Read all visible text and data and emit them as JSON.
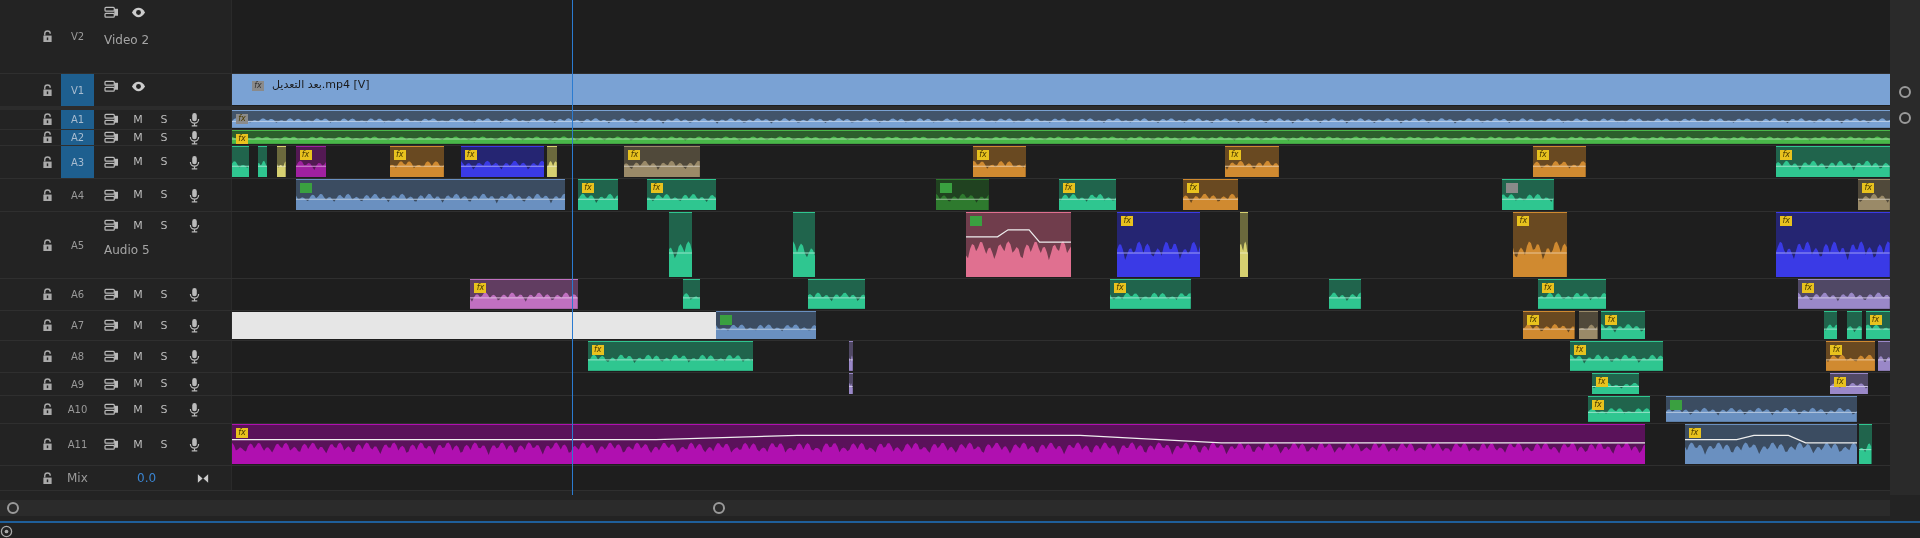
{
  "tracks": [
    {
      "kind": "video",
      "label": "V2",
      "name": "Video 2",
      "targeted": false
    },
    {
      "kind": "video",
      "label": "V1",
      "targeted": true,
      "clips": [
        {
          "kind": "video",
          "color": "#7aa2d4",
          "title": "بعد التعديل.mp4 [V]",
          "badge": {
            "text": "fx",
            "color": "#8a8a8a"
          }
        }
      ]
    },
    {
      "kind": "audio",
      "label": "A1",
      "mute": "M",
      "solo": "S",
      "targeted": true,
      "clips": [
        {
          "kind": "audio",
          "color": "#7aa2d4",
          "badge": {
            "text": "fx",
            "color": "#8a8a8a"
          }
        }
      ]
    },
    {
      "kind": "audio",
      "label": "A2",
      "mute": "M",
      "solo": "S",
      "targeted": true,
      "clips": [
        {
          "kind": "audio",
          "color": "#49b849",
          "badge": {
            "text": "fx",
            "color": "#e8c21e"
          }
        }
      ]
    },
    {
      "kind": "audio",
      "label": "A3",
      "mute": "M",
      "solo": "S",
      "targeted": true,
      "clips": [
        {
          "kind": "audio",
          "color": "#2fc690"
        },
        {
          "kind": "audio",
          "color": "#2fc690"
        },
        {
          "kind": "audio",
          "color": "#d6d070"
        },
        {
          "kind": "audio",
          "color": "#a020a0",
          "badge": {
            "text": "fx",
            "color": "#e8c21e"
          }
        },
        {
          "kind": "audio",
          "color": "#d08a30",
          "badge": {
            "text": "fx",
            "color": "#e8c21e"
          }
        },
        {
          "kind": "audio",
          "color": "#3a3ae6",
          "badge": {
            "text": "fx",
            "color": "#e8c21e"
          }
        },
        {
          "kind": "audio",
          "color": "#d6d070"
        },
        {
          "kind": "audio",
          "color": "#9a8a68",
          "badge": {
            "text": "fx",
            "color": "#e8c21e"
          }
        },
        {
          "kind": "audio",
          "color": "#d08a30",
          "badge": {
            "text": "fx",
            "color": "#e8c21e"
          }
        },
        {
          "kind": "audio",
          "color": "#d08a30",
          "badge": {
            "text": "fx",
            "color": "#e8c21e"
          }
        },
        {
          "kind": "audio",
          "color": "#d08a30",
          "badge": {
            "text": "fx",
            "color": "#e8c21e"
          }
        },
        {
          "kind": "audio",
          "color": "#2fc690",
          "badge": {
            "text": "fx",
            "color": "#e8c21e"
          }
        }
      ]
    },
    {
      "kind": "audio",
      "label": "A4",
      "mute": "M",
      "solo": "S",
      "targeted": false,
      "clips": [
        {
          "kind": "audio",
          "color": "#6a90c0",
          "badge": {
            "color": "#3aa040"
          }
        },
        {
          "kind": "audio",
          "color": "#2fc690",
          "badge": {
            "text": "fx",
            "color": "#e8c21e"
          }
        },
        {
          "kind": "audio",
          "color": "#2fc690",
          "badge": {
            "text": "fx",
            "color": "#e8c21e"
          }
        },
        {
          "kind": "audio",
          "color": "#2e7a2e",
          "badge": {
            "color": "#3aa040"
          }
        },
        {
          "kind": "audio",
          "color": "#2fc690",
          "badge": {
            "text": "fx",
            "color": "#e8c21e"
          }
        },
        {
          "kind": "audio",
          "color": "#d08a30",
          "badge": {
            "text": "fx",
            "color": "#e8c21e"
          }
        },
        {
          "kind": "audio",
          "color": "#2fc690",
          "badge": {
            "color": "#8a8a8a"
          }
        },
        {
          "kind": "audio",
          "color": "#9a8a68",
          "badge": {
            "text": "fx",
            "color": "#e8c21e"
          }
        }
      ]
    },
    {
      "kind": "audio",
      "label": "A5",
      "name": "Audio 5",
      "mute": "M",
      "solo": "S",
      "targeted": false,
      "clips": [
        {
          "kind": "audio",
          "color": "#2fc690"
        },
        {
          "kind": "audio",
          "color": "#2fc690"
        },
        {
          "kind": "audio",
          "color": "#e07090",
          "badge": {
            "color": "#3aa040"
          },
          "keyframes": true
        },
        {
          "kind": "audio",
          "color": "#3a3ae6",
          "badge": {
            "text": "fx",
            "color": "#e8c21e"
          }
        },
        {
          "kind": "audio",
          "color": "#d6d070"
        },
        {
          "kind": "audio",
          "color": "#d08a30",
          "badge": {
            "text": "fx",
            "color": "#e8c21e"
          }
        },
        {
          "kind": "audio",
          "color": "#3a3ae6",
          "badge": {
            "text": "fx",
            "color": "#e8c21e"
          }
        }
      ]
    },
    {
      "kind": "audio",
      "label": "A6",
      "mute": "M",
      "solo": "S",
      "targeted": false,
      "clips": [
        {
          "kind": "audio",
          "color": "#c070c0",
          "badge": {
            "text": "fx",
            "color": "#e8c21e"
          }
        },
        {
          "kind": "audio",
          "color": "#2fc690"
        },
        {
          "kind": "audio",
          "color": "#2fc690"
        },
        {
          "kind": "audio",
          "color": "#2fc690",
          "badge": {
            "text": "fx",
            "color": "#e8c21e"
          }
        },
        {
          "kind": "audio",
          "color": "#2fc690"
        },
        {
          "kind": "audio",
          "color": "#2fc690",
          "badge": {
            "text": "fx",
            "color": "#e8c21e"
          }
        },
        {
          "kind": "audio",
          "color": "#9a88c8",
          "badge": {
            "text": "fx",
            "color": "#e8c21e"
          }
        }
      ]
    },
    {
      "kind": "audio",
      "label": "A7",
      "mute": "M",
      "solo": "S",
      "targeted": false,
      "clips": [
        {
          "kind": "plain",
          "color": "#e6e6e6"
        },
        {
          "kind": "audio",
          "color": "#6a90c0",
          "badge": {
            "color": "#3aa040"
          }
        },
        {
          "kind": "audio",
          "color": "#d08a30",
          "badge": {
            "text": "fx",
            "color": "#e8c21e"
          }
        },
        {
          "kind": "audio",
          "color": "#9a8a68"
        },
        {
          "kind": "audio",
          "color": "#2fc690",
          "badge": {
            "text": "fx",
            "color": "#e8c21e"
          }
        },
        {
          "kind": "audio",
          "color": "#2fc690"
        },
        {
          "kind": "audio",
          "color": "#2fc690"
        },
        {
          "kind": "audio",
          "color": "#2fc690",
          "badge": {
            "text": "fx",
            "color": "#e8c21e"
          }
        }
      ]
    },
    {
      "kind": "audio",
      "label": "A8",
      "mute": "M",
      "solo": "S",
      "targeted": false,
      "clips": [
        {
          "kind": "audio",
          "color": "#2fc690",
          "badge": {
            "text": "fx",
            "color": "#e8c21e"
          }
        },
        {
          "kind": "audio",
          "color": "#9a88c8"
        },
        {
          "kind": "audio",
          "color": "#2fc690",
          "badge": {
            "text": "fx",
            "color": "#e8c21e"
          }
        },
        {
          "kind": "audio",
          "color": "#d08a30",
          "badge": {
            "text": "fx",
            "color": "#e8c21e"
          }
        },
        {
          "kind": "audio",
          "color": "#9a88c8"
        }
      ]
    },
    {
      "kind": "audio",
      "label": "A9",
      "mute": "M",
      "solo": "S",
      "targeted": false,
      "clips": [
        {
          "kind": "audio",
          "color": "#9a88c8"
        },
        {
          "kind": "audio",
          "color": "#2fc690",
          "badge": {
            "text": "fx",
            "color": "#e8c21e"
          }
        },
        {
          "kind": "audio",
          "color": "#9a88c8",
          "badge": {
            "text": "fx",
            "color": "#e8c21e"
          }
        }
      ]
    },
    {
      "kind": "audio",
      "label": "A10",
      "mute": "M",
      "solo": "S",
      "targeted": false,
      "clips": [
        {
          "kind": "audio",
          "color": "#2fc690",
          "badge": {
            "text": "fx",
            "color": "#e8c21e"
          }
        },
        {
          "kind": "audio",
          "color": "#6a90c0",
          "badge": {
            "color": "#3aa040"
          }
        }
      ]
    },
    {
      "kind": "audio",
      "label": "A11",
      "mute": "M",
      "solo": "S",
      "targeted": false,
      "clips": [
        {
          "kind": "audio",
          "color": "#b010b0",
          "badge": {
            "text": "fx",
            "color": "#e8c21e"
          },
          "keyframes": true
        },
        {
          "kind": "audio",
          "color": "#6a90c0",
          "badge": {
            "text": "fx",
            "color": "#e8c21e"
          },
          "keyframes": true
        },
        {
          "kind": "audio",
          "color": "#2fc690"
        }
      ]
    }
  ],
  "mix": {
    "label": "Mix",
    "value": "0.0"
  }
}
